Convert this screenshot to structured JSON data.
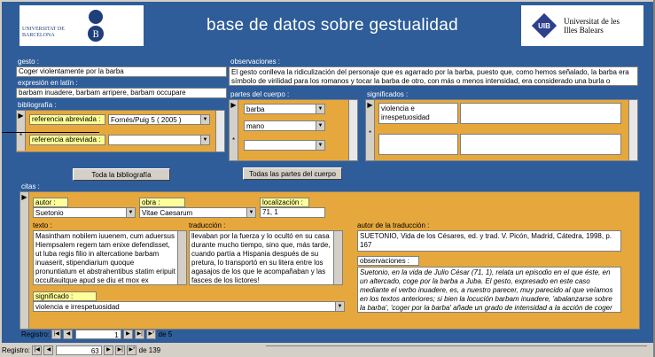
{
  "header": {
    "title": "base de datos sobre gestualidad",
    "logo_left_text": "UNIVERSITAT DE BARCELONA",
    "logo_right_line1": "Universitat de les",
    "logo_right_line2": "Illes Balears",
    "logo_right_mark": "UIB"
  },
  "gesto": {
    "label": "gesto :",
    "value": "Coger violentamente por la barba"
  },
  "observaciones": {
    "label": "observaciones :",
    "value": "El gesto conlleva la ridiculización del personaje que es agarrado por la barba, puesto que, como hemos señalado, la barba era símbolo de virilidad para los romanos y tocar la barba de otro, con más o menos intensidad, era considerado una burla o"
  },
  "expresion": {
    "label": "expresión en latín :",
    "value": "barbam inuadere, barbam arripere, barbam occupare"
  },
  "bibliografia": {
    "label": "bibliografía :",
    "rows": [
      {
        "label": "referencia abreviada :",
        "value": "Fornés/Puig 5 ( 2005 )"
      },
      {
        "label": "referencia abreviada :",
        "value": ""
      }
    ],
    "button": "Toda la bibliografía"
  },
  "partes": {
    "label": "partes del cuerpo :",
    "items": [
      "barba",
      "mano",
      ""
    ],
    "button": "Todas las partes del cuerpo"
  },
  "significados": {
    "label": "significados :",
    "items": [
      "violencia e irrespetuosidad",
      ""
    ]
  },
  "citas": {
    "label": "citas :",
    "autor": {
      "label": "autor :",
      "value": "Suetonio"
    },
    "obra": {
      "label": "obra :",
      "value": "Vitae Caesarum"
    },
    "localizacion": {
      "label": "localización :",
      "value": "71, 1"
    },
    "texto": {
      "label": "texto :",
      "value": "Masintham nobilem iuuenem, cum aduersus Hiempsalem regem tam enixe defendisset, ut luba regis filio in altercatione barbam inuaserit, stipendiarium quoque pronuntiatum et abstrahentibus statim eripuit occultauitque apud se diu et mox ex praetura proficiscens in Hispaniam inter"
    },
    "traduccion": {
      "label": "traducción :",
      "value": "llevaban por la fuerza y lo ocultó en su casa durante mucho tiempo, sino que, más tarde, cuando partía a Hispania después de su pretura, lo transportó en su litera entre los agasajos de los que le acompañaban y las fasces de los lictores!"
    },
    "autor_traduccion": {
      "label": "autor de la traducción :",
      "value": "SUETONIO, Vida de los Césares, ed. y trad. V. Picón, Madrid, Cátedra, 1998, p. 167"
    },
    "observaciones": {
      "label": "observaciones :",
      "value": "Suetonio, en la vida de Julio César (71, 1), relata un episodio en el que éste, en un altercado, coge por la barba a Juba. El gesto, expresado en este caso mediante el verbo inuadere, es, a nuestro parecer, muy parecido al que veíamos en los textos anteriores; si bien la locución barbam inuadere, 'abalanzarse sobre la barba', 'coger por la barba' añade un grado de intensidad a la acción de coger la barba."
    },
    "significado": {
      "label": "significado :",
      "value": "violencia e irrespetuosidad"
    }
  },
  "nav_inner": {
    "label": "Registro:",
    "current": "1",
    "total_text": "de 5"
  },
  "nav_outer": {
    "label": "Registro:",
    "current": "63",
    "total_text": "de 139"
  }
}
